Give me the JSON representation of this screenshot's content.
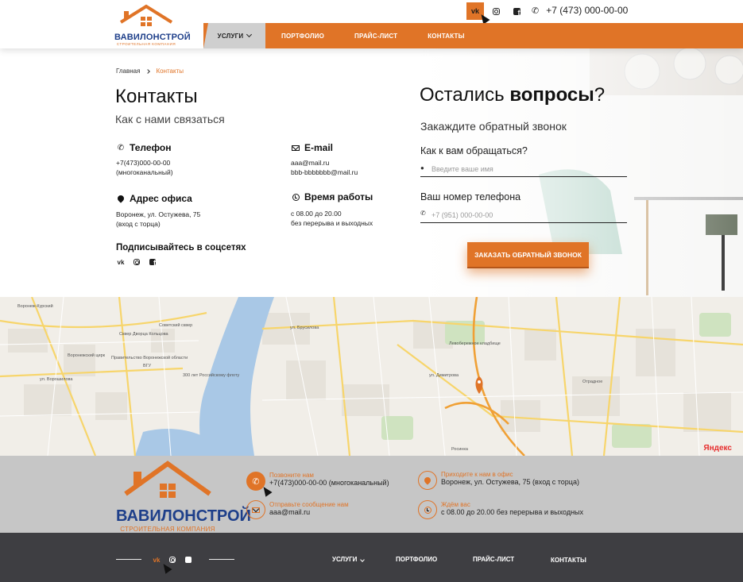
{
  "header": {
    "brand": {
      "name": "ВАВИЛОНСТРОЙ",
      "tagline": "Строительная компания"
    },
    "social": [
      {
        "icon": "vk-icon",
        "label": "vk"
      },
      {
        "icon": "instagram-icon"
      },
      {
        "icon": "facebook-icon"
      }
    ],
    "phone": "+7 (473) 000-00-00",
    "nav": [
      {
        "label": "Услуги",
        "has_dropdown": true
      },
      {
        "label": "Портфолио"
      },
      {
        "label": "Прайс-лист"
      },
      {
        "label": "Контакты"
      }
    ]
  },
  "breadcrumb": {
    "home": "Главная",
    "current": "Контакты"
  },
  "contacts": {
    "title": "Контакты",
    "subtitle": "Как с нами связаться",
    "phone": {
      "heading": "Телефон",
      "line1": "+7(473)000-00-00",
      "line2": "(многоканальный)"
    },
    "email": {
      "heading": "E-mail",
      "line1": "aaa@mail.ru",
      "line2": "bbb-bbbbbbb@mail.ru"
    },
    "address": {
      "heading": "Адрес офиса",
      "line1": "Воронеж, ул. Остужева, 75",
      "line2": "(вход с торца)"
    },
    "hours": {
      "heading": "Время работы",
      "line1": "с 08.00 до 20.00",
      "line2": "без перерыва и выходных"
    },
    "social_heading": "Подписывайтесь в соцсетях",
    "social_vk": "vk"
  },
  "form": {
    "title_normal": "Остались ",
    "title_bold": "вопросы",
    "title_end": "?",
    "subtitle": "Закаждите обратный звонок",
    "name_label": "Как к вам обращаться?",
    "name_placeholder": "Введите ваше имя",
    "phone_label": "Ваш номер телефона",
    "phone_placeholder": "+7 (951) 000-00-00",
    "submit": "Заказать обратный звонок"
  },
  "map": {
    "attribution": "Яндекс",
    "labels": [
      "Воронеж-Курский",
      "Воронежский цирк",
      "Правительство Воронежской области",
      "Советский сквер",
      "Сквер Дворца Кольцова",
      "ВГУ",
      "300 лет Российскому флоту",
      "ул. Брусилова",
      "Левобережное кладбище",
      "Отрадное",
      "Росинка",
      "ул. Димитрова",
      "ул. Ворошилова"
    ]
  },
  "footer": {
    "call_label": "Позвоните нам",
    "call_value": "+7(473)000-00-00 (многоканальный)",
    "office_label": "Приходите к нам в офис",
    "office_value": "Воронеж, ул. Остужева, 75 (вход с торца)",
    "mail_label": "Отправьте сообщение нам",
    "mail_value": "aaa@mail.ru",
    "hours_label": "Ждём вас",
    "hours_value": "с 08.00 до 20.00 без перерыва и выходных",
    "social_vk": "vk",
    "nav": [
      {
        "label": "Услуги",
        "has_dropdown": true
      },
      {
        "label": "Портфолио"
      },
      {
        "label": "Прайс-лист"
      },
      {
        "label": "Контакты"
      }
    ]
  },
  "colors": {
    "accent": "#e07427",
    "brand_blue": "#1e3f8a",
    "footer_dark": "#3e3e42",
    "footer_light": "#c6c6c6"
  }
}
